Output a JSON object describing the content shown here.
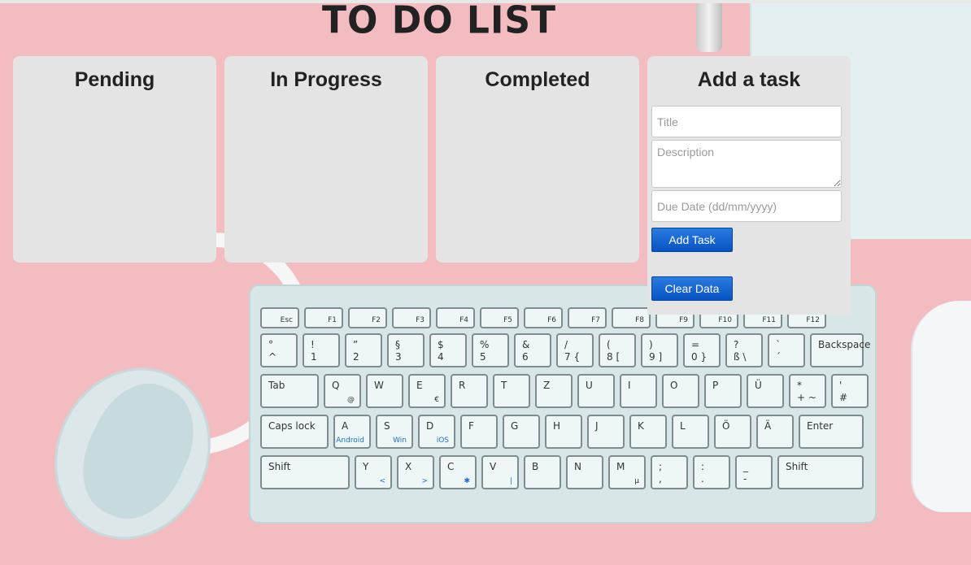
{
  "page": {
    "title": "TO DO LIST"
  },
  "columns": [
    {
      "title": "Pending"
    },
    {
      "title": "In Progress"
    },
    {
      "title": "Completed"
    }
  ],
  "add_task": {
    "heading": "Add a task",
    "title_placeholder": "Title",
    "description_placeholder": "Description",
    "due_placeholder": "Due Date (dd/mm/yyyy)",
    "add_button": "Add Task",
    "clear_button": "Clear Data"
  },
  "keyboard": {
    "fn_row": [
      "Esc",
      "F1",
      "F2",
      "F3",
      "F4",
      "F5",
      "F6",
      "F7",
      "F8",
      "F9",
      "F10",
      "F11",
      "F12"
    ],
    "row1": [
      {
        "top": "°",
        "bot": "^"
      },
      {
        "top": "!",
        "bot": "1"
      },
      {
        "top": "”",
        "bot": "2"
      },
      {
        "top": "§",
        "bot": "3"
      },
      {
        "top": "$",
        "bot": "4"
      },
      {
        "top": "%",
        "bot": "5"
      },
      {
        "top": "&",
        "bot": "6"
      },
      {
        "top": "/",
        "bot": "7 {"
      },
      {
        "top": "(",
        "bot": "8 ["
      },
      {
        "top": ")",
        "bot": "9 ]"
      },
      {
        "top": "=",
        "bot": "0 }"
      },
      {
        "top": "?",
        "bot": "ß \\"
      },
      {
        "top": "`",
        "bot": "´"
      },
      {
        "top": "Backspace",
        "bot": ""
      }
    ],
    "row2": [
      {
        "top": "Tab",
        "bot": ""
      },
      {
        "top": "Q",
        "bot": "",
        "sub": "@"
      },
      {
        "top": "W",
        "bot": ""
      },
      {
        "top": "E",
        "bot": "",
        "sub": "€"
      },
      {
        "top": "R",
        "bot": ""
      },
      {
        "top": "T",
        "bot": ""
      },
      {
        "top": "Z",
        "bot": ""
      },
      {
        "top": "U",
        "bot": ""
      },
      {
        "top": "I",
        "bot": ""
      },
      {
        "top": "O",
        "bot": ""
      },
      {
        "top": "P",
        "bot": ""
      },
      {
        "top": "Ü",
        "bot": ""
      },
      {
        "top": "*",
        "bot": "+ ~"
      },
      {
        "top": "'",
        "bot": "#"
      }
    ],
    "row3": [
      {
        "top": "Caps lock",
        "bot": ""
      },
      {
        "top": "A",
        "bot": "",
        "sub": "Android",
        "blue": true
      },
      {
        "top": "S",
        "bot": "",
        "sub": "Win",
        "blue": true
      },
      {
        "top": "D",
        "bot": "",
        "sub": "iOS",
        "blue": true
      },
      {
        "top": "F",
        "bot": ""
      },
      {
        "top": "G",
        "bot": ""
      },
      {
        "top": "H",
        "bot": ""
      },
      {
        "top": "J",
        "bot": ""
      },
      {
        "top": "K",
        "bot": ""
      },
      {
        "top": "L",
        "bot": ""
      },
      {
        "top": "Ö",
        "bot": ""
      },
      {
        "top": "Ä",
        "bot": ""
      },
      {
        "top": "Enter",
        "bot": ""
      }
    ],
    "row4": [
      {
        "top": "Shift",
        "bot": ""
      },
      {
        "top": "Y",
        "bot": "",
        "sub": "<",
        "blue": true
      },
      {
        "top": "X",
        "bot": "",
        "sub": ">",
        "blue": true
      },
      {
        "top": "C",
        "bot": "",
        "sub": "✱",
        "blue": true
      },
      {
        "top": "V",
        "bot": "",
        "sub": "|",
        "blue": true
      },
      {
        "top": "B",
        "bot": ""
      },
      {
        "top": "N",
        "bot": ""
      },
      {
        "top": "M",
        "bot": "",
        "sub": "µ"
      },
      {
        "top": ";",
        "bot": ","
      },
      {
        "top": ":",
        "bot": "."
      },
      {
        "top": "_",
        "bot": "-"
      },
      {
        "top": "Shift",
        "bot": ""
      }
    ]
  },
  "colors": {
    "background": "#f3bcc0",
    "panel": "#e4e4e4",
    "button": "#0a5ed0"
  }
}
